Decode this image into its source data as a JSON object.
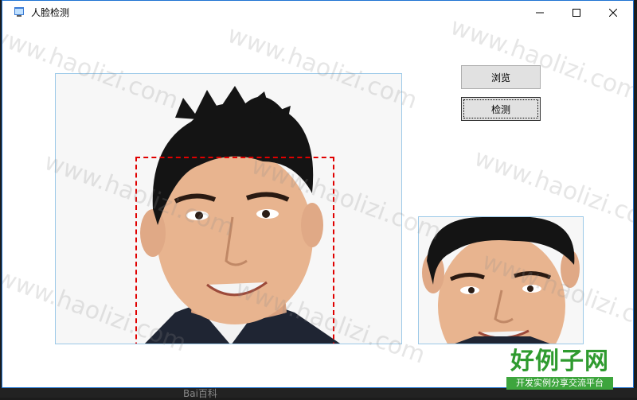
{
  "window": {
    "title": "人脸检测"
  },
  "buttons": {
    "browse_label": "浏览",
    "detect_label": "检测"
  },
  "watermark": {
    "text": "www.haolizi.com"
  },
  "logo": {
    "main_text": "好例子网",
    "sub_text": "开发实例分享交流平台"
  },
  "background_text": "Bai百科",
  "colors": {
    "face_box": "#e00000",
    "image_border": "#9cc9e8",
    "logo_green": "#2f9b2f"
  },
  "icons": {
    "app": "app-window-icon",
    "minimize": "minimize-icon",
    "maximize": "maximize-icon",
    "close": "close-icon"
  }
}
